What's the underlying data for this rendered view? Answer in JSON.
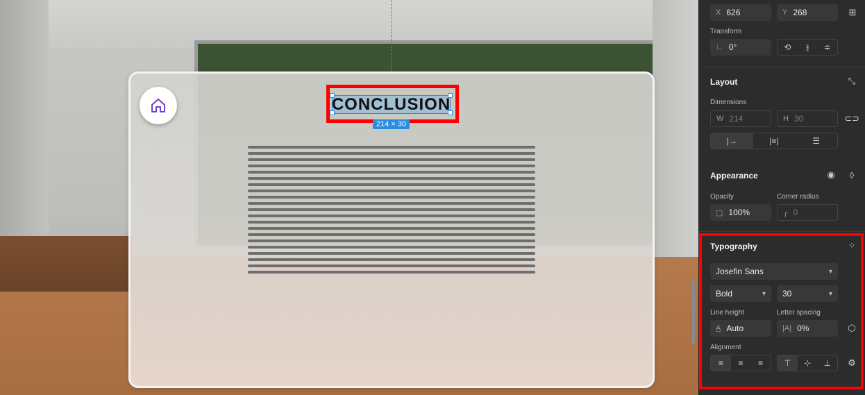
{
  "canvas": {
    "title_text": "CONCLUSION",
    "dimensions_badge": "214 × 30",
    "text_line_count": 21
  },
  "properties": {
    "position": {
      "x_label": "X",
      "x_value": "626",
      "y_label": "Y",
      "y_value": "268"
    },
    "transform": {
      "label": "Transform",
      "rotation": "0°"
    },
    "layout": {
      "label": "Layout",
      "dimensions_label": "Dimensions",
      "w_label": "W",
      "w_value": "214",
      "h_label": "H",
      "h_value": "30"
    },
    "appearance": {
      "label": "Appearance",
      "opacity_label": "Opacity",
      "opacity_value": "100%",
      "corner_radius_label": "Corner radius",
      "corner_radius_value": "0"
    },
    "typography": {
      "label": "Typography",
      "font_family": "Josefin Sans",
      "font_weight": "Bold",
      "font_size": "30",
      "line_height_label": "Line height",
      "line_height_value": "Auto",
      "letter_spacing_label": "Letter spacing",
      "letter_spacing_value": "0%",
      "alignment_label": "Alignment"
    }
  },
  "colors": {
    "selection_blue": "#2a8de0",
    "highlight_red": "#ff0000",
    "panel_bg": "#2c2c2c",
    "home_icon": "#6b3fd6"
  }
}
